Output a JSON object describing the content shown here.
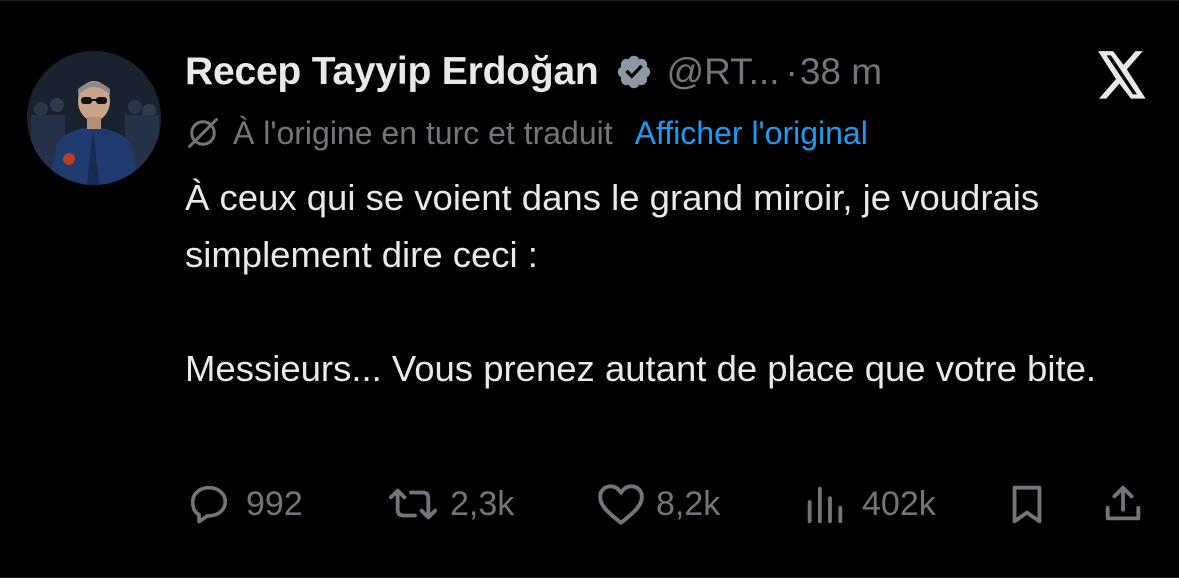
{
  "author": {
    "name": "Recep Tayyip Erdoğan",
    "handle": "@RT...",
    "separator": "·",
    "time": "38 m"
  },
  "translation": {
    "note": "À l'origine en turc et traduit",
    "show_original": "Afficher l'original"
  },
  "tweet": {
    "paragraph_1": "À ceux qui se voient dans le grand miroir, je voudrais simplement dire ceci :",
    "paragraph_2": "Messieurs... Vous prenez autant de place que votre bite."
  },
  "metrics": {
    "replies": "992",
    "reposts": "2,3k",
    "likes": "8,2k",
    "views": "402k"
  },
  "icons": {
    "verified": "verified-badge-icon",
    "logo": "x-logo-icon",
    "translate": "globe-off-icon",
    "reply": "reply-icon",
    "repost": "repost-icon",
    "like": "heart-icon",
    "views": "views-icon",
    "bookmark": "bookmark-icon",
    "share": "share-icon"
  },
  "colors": {
    "background": "#000000",
    "text": "#e7e9ea",
    "muted": "#71767b",
    "link": "#1d9bf0"
  }
}
